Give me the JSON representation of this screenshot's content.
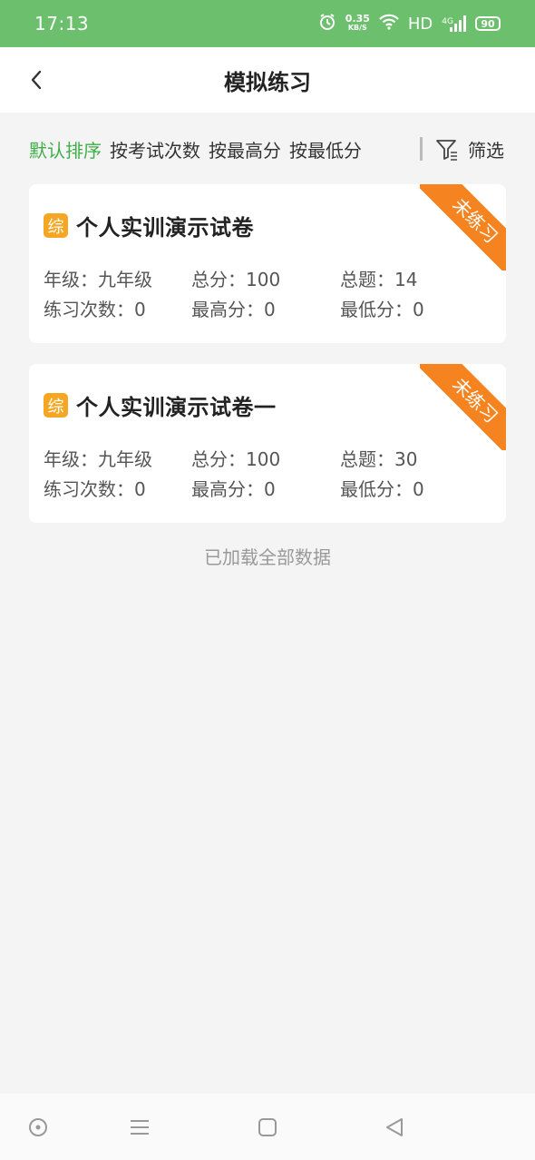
{
  "status_bar": {
    "time": "17:13",
    "net_speed_value": "0.35",
    "net_speed_unit": "KB/S",
    "hd_label": "HD",
    "network_label": "4G",
    "battery": "90"
  },
  "nav": {
    "title": "模拟练习",
    "back_icon": "chevron-left-icon"
  },
  "sort_bar": {
    "options": [
      "默认排序",
      "按考试次数",
      "按最高分",
      "按最低分"
    ],
    "active_index": 0,
    "filter_label": "筛选",
    "filter_icon": "filter-funnel-icon"
  },
  "papers": [
    {
      "badge": "综",
      "title": "个人实训演示试卷",
      "grade": "年级：九年级",
      "total_score": "总分：100",
      "total_questions": "总题：14",
      "practice_count": "练习次数：0",
      "max_score": "最高分：0",
      "min_score": "最低分：0",
      "ribbon": "未练习"
    },
    {
      "badge": "综",
      "title": "个人实训演示试卷一",
      "grade": "年级：九年级",
      "total_score": "总分：100",
      "total_questions": "总题：30",
      "practice_count": "练习次数：0",
      "max_score": "最高分：0",
      "min_score": "最低分：0",
      "ribbon": "未练习"
    }
  ],
  "footer_text": "已加载全部数据",
  "colors": {
    "status_bar": "#6cbf6c",
    "active_sort": "#3fae49",
    "badge": "#f5a623",
    "ribbon": "#f5831f"
  }
}
